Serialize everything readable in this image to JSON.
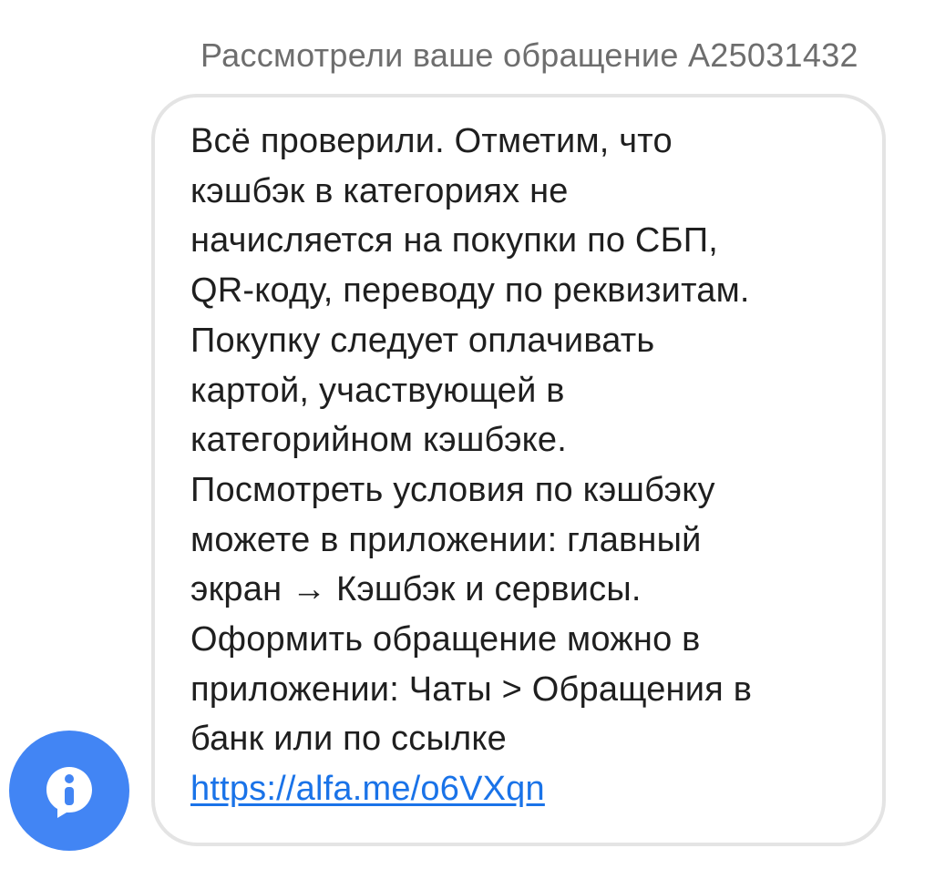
{
  "header": {
    "title": "Рассмотрели ваше обращение A25031432"
  },
  "message": {
    "lines": [
      "Всё проверили. Отметим, что",
      "кэшбэк в категориях не",
      "начисляется на покупки по СБП,",
      "QR-коду, переводу по реквизитам.",
      "Покупку следует оплачивать",
      "картой, участвующей в",
      "категорийном кэшбэке.",
      "Посмотреть условия по кэшбэку",
      "можете в приложении: главный",
      "экран → Кэшбэк и сервисы.",
      "Оформить обращение можно в",
      "приложении: Чаты > Обращения в",
      "банк или по ссылке"
    ],
    "link": "https://alfa.me/o6VXqn"
  },
  "sender": {
    "icon": "info-chat-icon",
    "color": "#4285f4"
  }
}
